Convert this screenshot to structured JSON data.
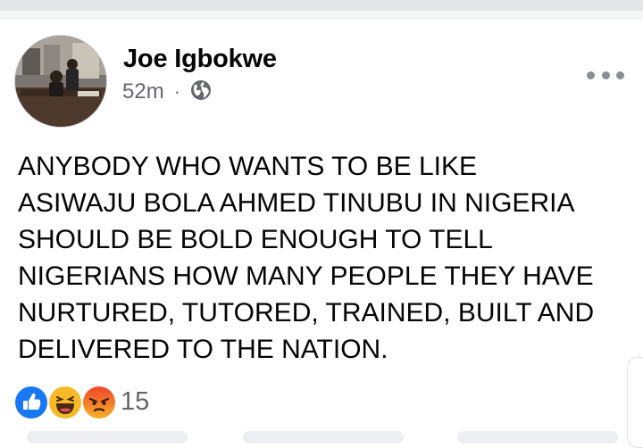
{
  "post": {
    "author": "Joe Igbokwe",
    "time": "52m",
    "separator": "·",
    "audience_icon": "globe-icon",
    "more_icon": "ellipsis-icon",
    "text_lines": [
      "ANYBODY WHO WANTS TO BE LIKE",
      "ASIWAJU BOLA AHMED TINUBU IN NIGERIA",
      "SHOULD BE BOLD ENOUGH TO TELL",
      "NIGERIANS HOW MANY PEOPLE THEY HAVE",
      "NURTURED, TUTORED, TRAINED, BUILT AND",
      "DELIVERED TO THE NATION."
    ]
  },
  "reactions": {
    "icons": [
      "like-icon",
      "haha-icon",
      "angry-icon"
    ],
    "count": "15"
  },
  "colors": {
    "like": "#1877f2",
    "haha": "#f7b928",
    "angry": "#e9710f",
    "muted_text": "#65676b",
    "primary_text": "#050505"
  }
}
